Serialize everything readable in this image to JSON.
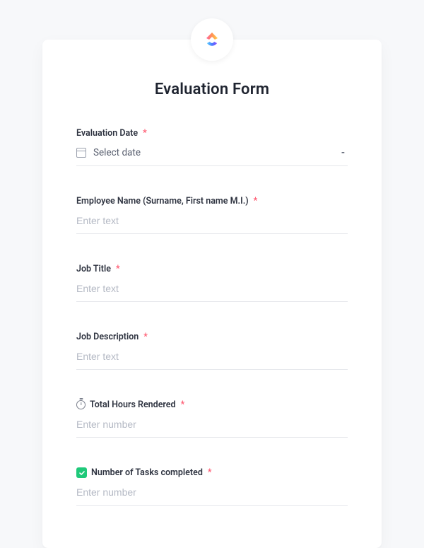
{
  "form": {
    "title": "Evaluation Form",
    "required_marker": "*",
    "fields": {
      "evaluation_date": {
        "label": "Evaluation Date",
        "placeholder": "Select date"
      },
      "employee_name": {
        "label": "Employee Name (Surname, First name M.I.)",
        "placeholder": "Enter text"
      },
      "job_title": {
        "label": "Job Title",
        "placeholder": "Enter text"
      },
      "job_description": {
        "label": "Job Description",
        "placeholder": "Enter text"
      },
      "total_hours": {
        "label": "Total Hours Rendered",
        "placeholder": "Enter number"
      },
      "tasks_completed": {
        "label": "Number of Tasks completed",
        "placeholder": "Enter number"
      }
    }
  }
}
